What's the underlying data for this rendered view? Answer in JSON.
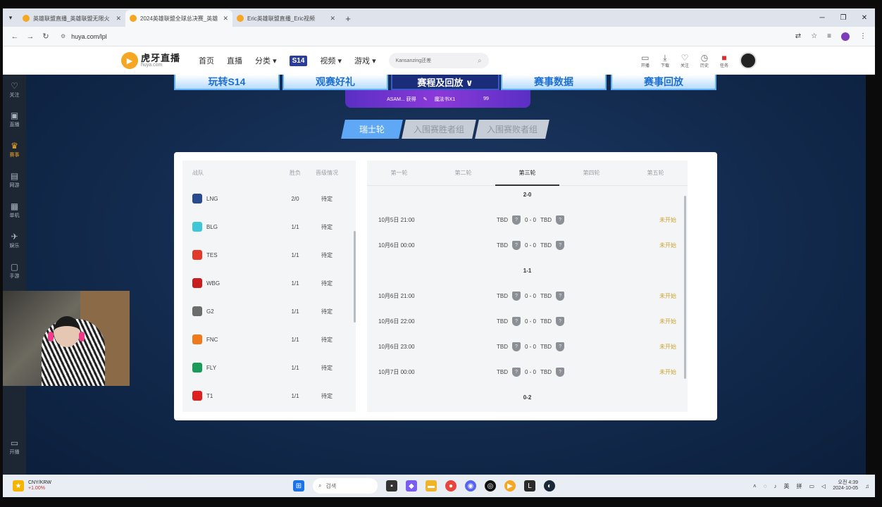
{
  "browser": {
    "tabs": [
      {
        "title": "英雄联盟直播_英雄联盟无限火",
        "active": false
      },
      {
        "title": "2024英雄联盟全球总决赛_英雄",
        "active": true
      },
      {
        "title": "Eric英雄联盟直播_Eric视频",
        "active": false
      }
    ],
    "new_tab": "+",
    "url": "huya.com/lpl"
  },
  "huya": {
    "logo_text": "虎牙直播",
    "logo_sub": "huya.com",
    "nav": [
      "首页",
      "直播",
      "分类",
      "视频",
      "游戏"
    ],
    "s14_label": "S14",
    "search_placeholder": "Kansanzing还差",
    "tools": [
      {
        "icon": "broadcast-icon",
        "label": "开播"
      },
      {
        "icon": "download-icon",
        "label": "下载"
      },
      {
        "icon": "heart-icon",
        "label": "关注"
      },
      {
        "icon": "history-icon",
        "label": "历史"
      },
      {
        "icon": "gift-icon",
        "label": "任务"
      }
    ]
  },
  "sidebar": [
    {
      "label": "关注",
      "icon": "heart-icon",
      "active": false
    },
    {
      "label": "直播",
      "icon": "tv-icon",
      "active": false
    },
    {
      "label": "赛事",
      "icon": "trophy-icon",
      "active": true
    },
    {
      "label": "网游",
      "icon": "game-icon",
      "active": false
    },
    {
      "label": "单机",
      "icon": "controller-icon",
      "active": false
    },
    {
      "label": "娱乐",
      "icon": "rocket-icon",
      "active": false
    },
    {
      "label": "手游",
      "icon": "phone-icon",
      "active": false
    },
    {
      "label": "开播",
      "icon": "camera-icon",
      "active": false
    }
  ],
  "banners": [
    "玩转S14",
    "观赛好礼",
    "赛程及回放 ∨",
    "赛事数据",
    "赛事回放"
  ],
  "promo": {
    "text": "ASAM... 获得",
    "item": "魔法书X1",
    "count": "99"
  },
  "stage_tabs": [
    "瑞士轮",
    "入围赛胜者组",
    "入围赛败者组"
  ],
  "standings": {
    "headers": [
      "战队",
      "胜负",
      "晋级情况"
    ],
    "rows": [
      {
        "team": "LNG",
        "record": "2/0",
        "status": "待定",
        "color": "#2a4a8f"
      },
      {
        "team": "BLG",
        "record": "1/1",
        "status": "待定",
        "color": "#3ec6d9"
      },
      {
        "team": "TES",
        "record": "1/1",
        "status": "待定",
        "color": "#e2392a"
      },
      {
        "team": "WBG",
        "record": "1/1",
        "status": "待定",
        "color": "#c81e1e"
      },
      {
        "team": "G2",
        "record": "1/1",
        "status": "待定",
        "color": "#6c6c6c"
      },
      {
        "team": "FNC",
        "record": "1/1",
        "status": "待定",
        "color": "#f07a1a"
      },
      {
        "team": "FLY",
        "record": "1/1",
        "status": "待定",
        "color": "#1b9b5a"
      },
      {
        "team": "T1",
        "record": "1/1",
        "status": "待定",
        "color": "#e0201f"
      }
    ]
  },
  "rounds": {
    "tabs": [
      "第一轮",
      "第二轮",
      "第三轮",
      "第四轮",
      "第五轮"
    ],
    "active_index": 2,
    "groups": [
      {
        "label": "2-0",
        "matches": [
          {
            "time": "10月5日 21:00",
            "team_a": "TBD",
            "score": "0 - 0",
            "team_b": "TBD",
            "status": "未开始"
          },
          {
            "time": "10月6日 00:00",
            "team_a": "TBD",
            "score": "0 - 0",
            "team_b": "TBD",
            "status": "未开始"
          }
        ]
      },
      {
        "label": "1-1",
        "matches": [
          {
            "time": "10月6日 21:00",
            "team_a": "TBD",
            "score": "0 - 0",
            "team_b": "TBD",
            "status": "未开始"
          },
          {
            "time": "10月6日 22:00",
            "team_a": "TBD",
            "score": "0 - 0",
            "team_b": "TBD",
            "status": "未开始"
          },
          {
            "time": "10月6日 23:00",
            "team_a": "TBD",
            "score": "0 - 0",
            "team_b": "TBD",
            "status": "未开始"
          },
          {
            "time": "10月7日 00:00",
            "team_a": "TBD",
            "score": "0 - 0",
            "team_b": "TBD",
            "status": "未开始"
          }
        ]
      },
      {
        "label": "0-2",
        "matches": []
      }
    ]
  },
  "taskbar": {
    "fx_pair": "CNY/KRW",
    "fx_change": "+1.00%",
    "search_placeholder": "검색",
    "ime": "英",
    "ime2": "拼",
    "time": "오전 4:39",
    "date": "2024-10-05"
  }
}
